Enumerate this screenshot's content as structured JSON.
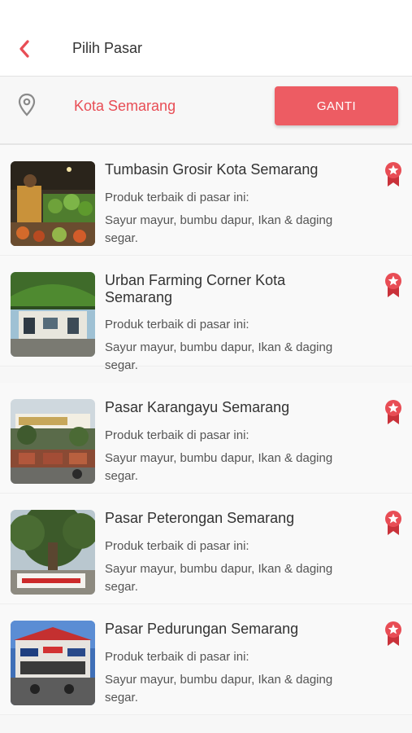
{
  "header": {
    "title": "Pilih Pasar",
    "back_icon": "chevron-left-icon"
  },
  "location": {
    "city": "Kota Semarang",
    "button_label": "GANTI",
    "pin_icon": "map-pin-icon"
  },
  "colors": {
    "accent": "#ed5c63",
    "accent_text": "#e84d55"
  },
  "markets": [
    {
      "name": "Tumbasin Grosir Kota Semarang",
      "subtitle": "Produk terbaik di pasar ini:",
      "description": "Sayur mayur, bumbu dapur, Ikan & daging segar.",
      "badge_icon": "award-ribbon-icon"
    },
    {
      "name": "Urban Farming Corner Kota Semarang",
      "subtitle": "Produk terbaik di pasar ini:",
      "description": "Sayur mayur, bumbu dapur, Ikan & daging segar.",
      "badge_icon": "award-ribbon-icon"
    },
    {
      "name": "Pasar Karangayu Semarang",
      "subtitle": "Produk terbaik di pasar ini:",
      "description": "Sayur mayur, bumbu dapur, Ikan & daging segar.",
      "badge_icon": "award-ribbon-icon"
    },
    {
      "name": "Pasar Peterongan Semarang",
      "subtitle": "Produk terbaik di pasar ini:",
      "description": "Sayur mayur, bumbu dapur, Ikan & daging segar.",
      "badge_icon": "award-ribbon-icon"
    },
    {
      "name": "Pasar Pedurungan Semarang",
      "subtitle": "Produk terbaik di pasar ini:",
      "description": "Sayur mayur, bumbu dapur, Ikan & daging segar.",
      "badge_icon": "award-ribbon-icon"
    }
  ]
}
